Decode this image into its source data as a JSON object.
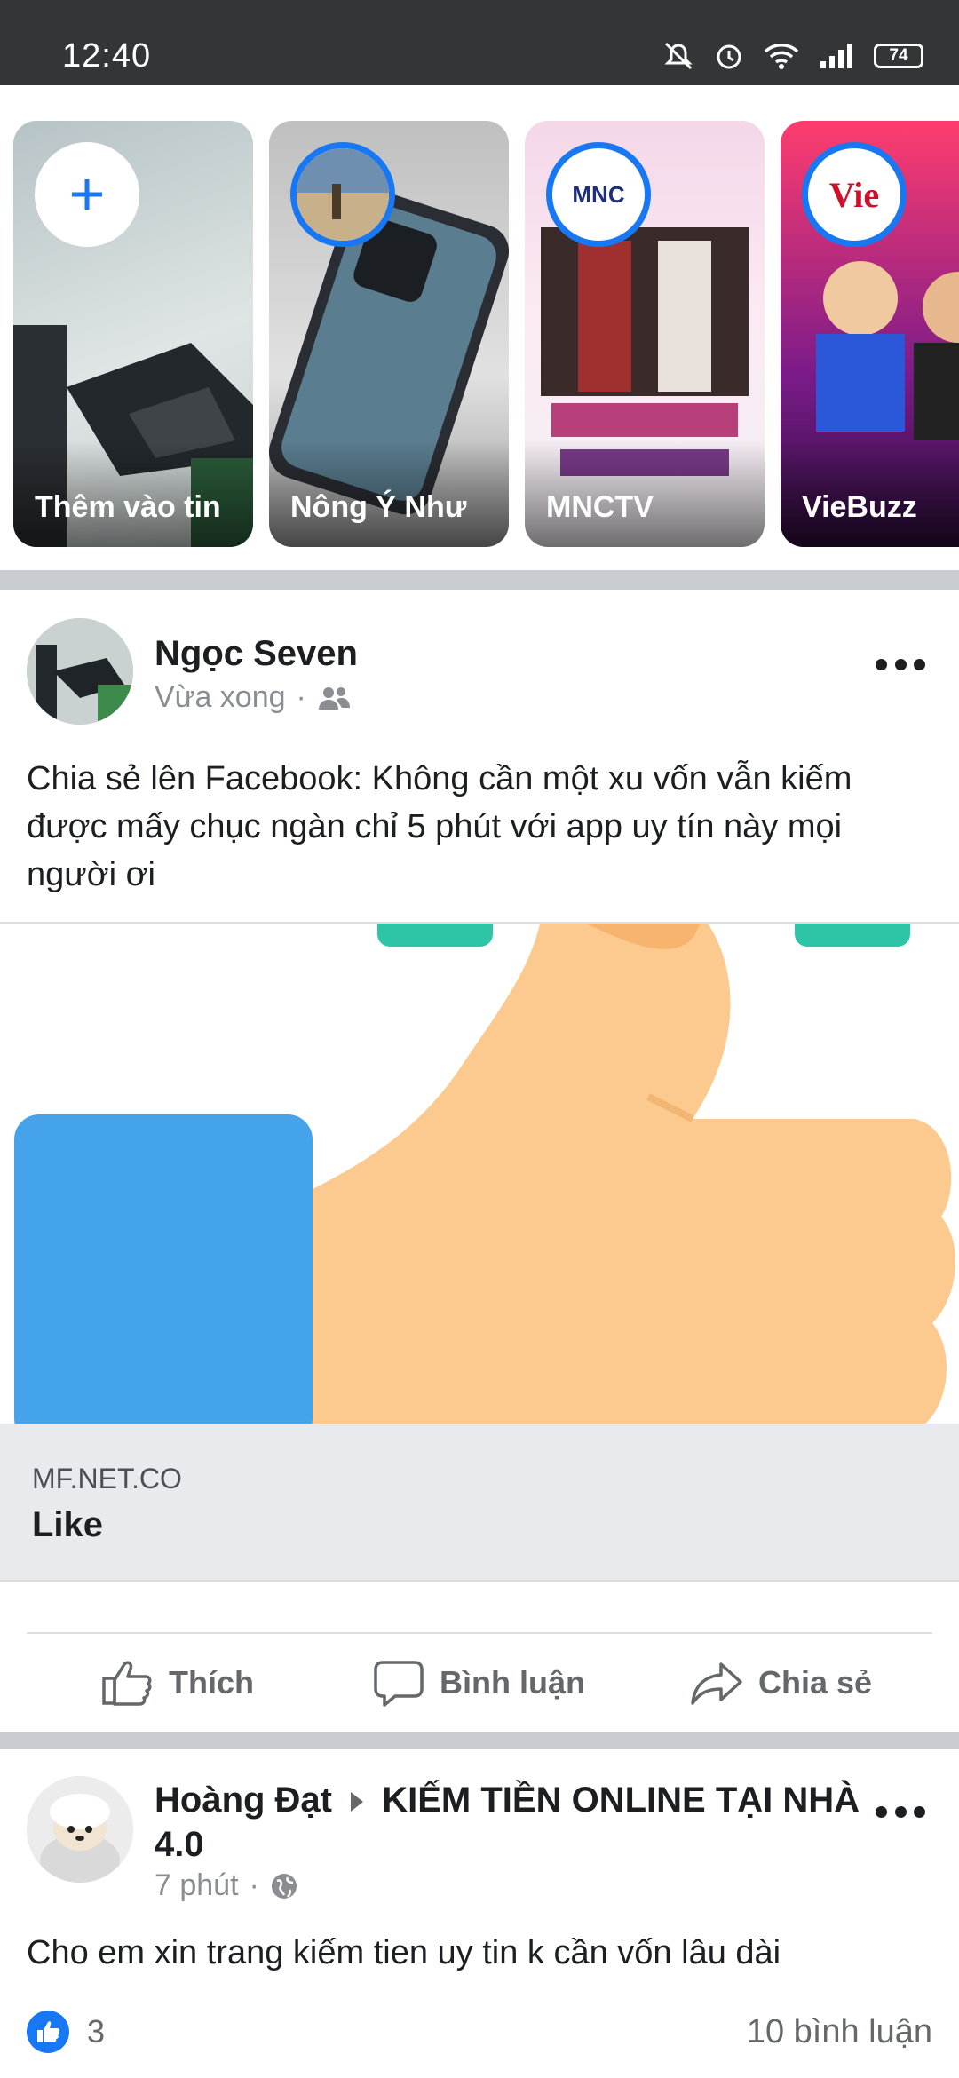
{
  "status_bar": {
    "time": "12:40",
    "battery": "74",
    "icons": [
      "mute-icon",
      "alarm-icon",
      "wifi-icon",
      "signal-icon",
      "battery-icon"
    ]
  },
  "stories": [
    {
      "label": "Thêm vào tin",
      "type": "add"
    },
    {
      "label": "Nông Ý Như",
      "type": "story"
    },
    {
      "label": "MNCTV",
      "type": "story",
      "logo_text": "MNC"
    },
    {
      "label": "VieBuzz",
      "type": "story",
      "logo_text": "Vie"
    }
  ],
  "posts": [
    {
      "author": "Ngọc Seven",
      "time": "Vừa xong",
      "privacy_icon": "friends-icon",
      "text": "Chia sẻ lên Facebook: Không cần một xu vốn vẫn kiếm được mấy chục ngàn chỉ 5 phút với app uy tín này mọi người ơi",
      "link": {
        "domain": "MF.NET.CO",
        "title": "Like"
      },
      "actions": {
        "like": "Thích",
        "comment": "Bình luận",
        "share": "Chia sẻ"
      }
    },
    {
      "author": "Hoàng Đạt",
      "group": "KIẾM TIỀN ONLINE TẠI NHÀ 4.0",
      "time": "7 phút",
      "privacy_icon": "globe-icon",
      "text": "Cho em xin trang kiếm tien uy tin k cần vốn lâu dài",
      "likes": "3",
      "comments": "10 bình luận"
    }
  ],
  "colors": {
    "status_bar": "#343537",
    "accent": "#1877f2",
    "separator": "#c9ccd1",
    "thumb": "#fcc98f",
    "cuff": "#44a3ea",
    "teal": "#2ec4a6"
  }
}
